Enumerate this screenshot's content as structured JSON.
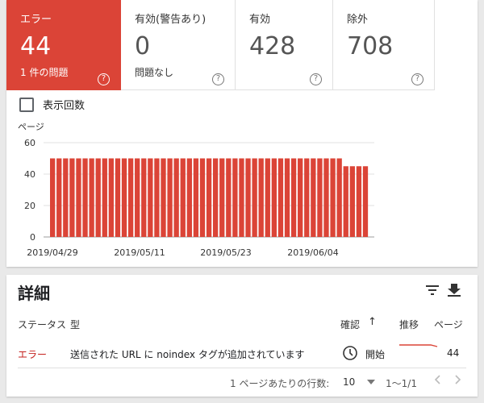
{
  "tiles": [
    {
      "label": "エラー",
      "count": "44",
      "sub": "1 件の問題",
      "help": "?"
    },
    {
      "label": "有効(警告あり)",
      "count": "0",
      "sub": "問題なし",
      "help": "?"
    },
    {
      "label": "有効",
      "count": "428",
      "sub": "",
      "help": "?"
    },
    {
      "label": "除外",
      "count": "708",
      "sub": "",
      "help": "?"
    }
  ],
  "impressions_label": "表示回数",
  "colors": {
    "error": "#db4437",
    "bar": "#db4437",
    "grid": "#e0e0e0"
  },
  "chart_data": {
    "type": "bar",
    "ylabel": "ページ",
    "ylim": [
      0,
      60
    ],
    "yticks": [
      "60",
      "40",
      "20",
      "0"
    ],
    "xticks": [
      "2019/04/29",
      "2019/05/11",
      "2019/05/23",
      "2019/06/04"
    ],
    "series": [
      {
        "values": [
          50,
          50,
          50,
          50,
          50,
          50,
          50,
          50,
          50,
          50,
          50,
          50,
          50,
          50,
          50,
          50,
          50,
          50,
          50,
          50,
          50,
          50,
          50,
          50,
          50,
          50,
          50,
          50,
          50,
          50,
          50,
          50,
          50,
          50,
          50,
          50,
          50,
          50,
          50,
          50,
          50,
          50,
          50,
          50,
          50,
          45,
          45,
          45,
          45
        ]
      }
    ]
  },
  "details": {
    "title": "詳細",
    "filter_icon": "filter-icon",
    "download_icon": "download-icon",
    "columns": {
      "status": "ステータス",
      "type": "型",
      "validation": "確認",
      "sort_arrow": "↑",
      "trend": "推移",
      "pages": "ページ"
    },
    "row": {
      "status": "エラー",
      "type": "送信された URL に noindex タグが追加されています",
      "validation": "開始",
      "pages": "44"
    },
    "pagination": {
      "rows_per_page_label": "1 ページあたりの行数:",
      "rows_per_page": "10",
      "range": "1〜1/1"
    }
  }
}
